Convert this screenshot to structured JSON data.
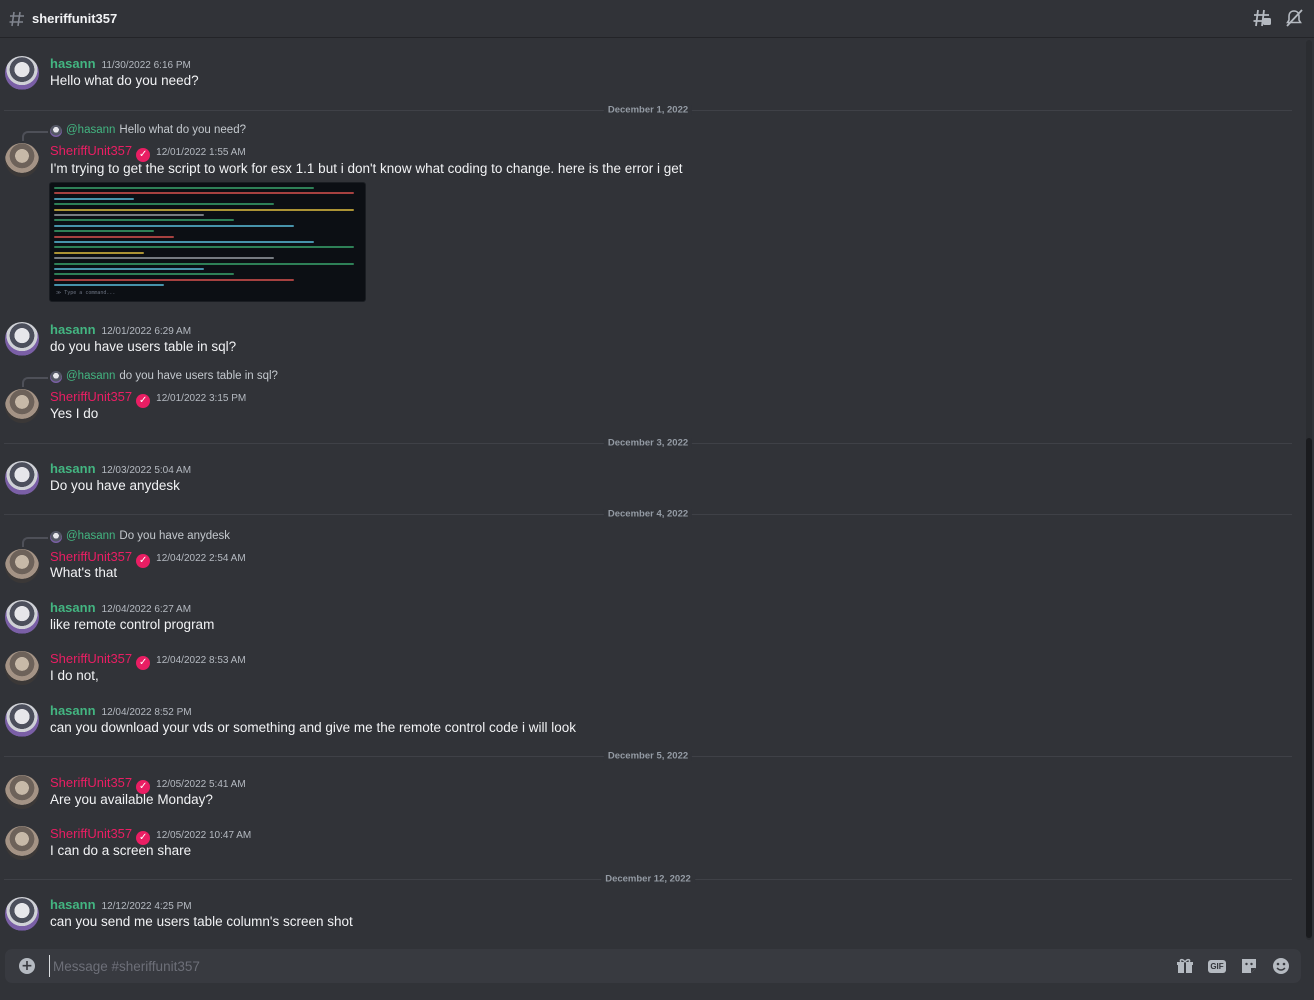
{
  "channel": {
    "name": "sheriffunit357"
  },
  "composer": {
    "placeholder": "Message #sheriffunit357"
  },
  "dividers": [
    "December 1, 2022",
    "December 3, 2022",
    "December 4, 2022",
    "December 5, 2022",
    "December 12, 2022"
  ],
  "messages": [
    {
      "author": "hasann",
      "timestamp": "11/30/2022 6:16 PM",
      "text": "Hello what do you need?"
    },
    {
      "author": "SheriffUnit357",
      "timestamp": "12/01/2022 1:55 AM",
      "text": "I'm trying to get the script to work for esx 1.1 but i don't know what coding to change. here is the error i get",
      "reply": {
        "author": "@hasann",
        "text": "Hello what do you need?"
      }
    },
    {
      "author": "hasann",
      "timestamp": "12/01/2022 6:29 AM",
      "text": "do you have users table in sql?"
    },
    {
      "author": "SheriffUnit357",
      "timestamp": "12/01/2022 3:15 PM",
      "text": "Yes I do",
      "reply": {
        "author": "@hasann",
        "text": "do you have users table in sql?"
      }
    },
    {
      "author": "hasann",
      "timestamp": "12/03/2022 5:04 AM",
      "text": "Do you have anydesk"
    },
    {
      "author": "SheriffUnit357",
      "timestamp": "12/04/2022 2:54 AM",
      "text": "What's that",
      "reply": {
        "author": "@hasann",
        "text": "Do you have anydesk"
      }
    },
    {
      "author": "hasann",
      "timestamp": "12/04/2022 6:27 AM",
      "text": "like remote control program"
    },
    {
      "author": "SheriffUnit357",
      "timestamp": "12/04/2022 8:53 AM",
      "text": "I do not,"
    },
    {
      "author": "hasann",
      "timestamp": "12/04/2022 8:52 PM",
      "text": "can you download your vds or something and give me the remote control code i will look"
    },
    {
      "author": "SheriffUnit357",
      "timestamp": "12/05/2022 5:41 AM",
      "text": "Are you available Monday?"
    },
    {
      "author": "SheriffUnit357",
      "timestamp": "12/05/2022 10:47 AM",
      "text": "I can do a screen share"
    },
    {
      "author": "hasann",
      "timestamp": "12/12/2022 4:25 PM",
      "text": "can you send me users table column's screen shot"
    }
  ],
  "attachment": {
    "prompt": "≫ Type a command..."
  },
  "icons": {
    "header": [
      "threads-icon",
      "notification-off-icon"
    ],
    "composer": [
      "add-icon",
      "gift-icon",
      "gif-icon",
      "sticker-icon",
      "emoji-icon"
    ]
  },
  "colors": {
    "hasann": "#43b581",
    "sheriff": "#e91e63",
    "background": "#313338"
  },
  "composer_labels": {
    "gif": "GIF",
    "plus": "+"
  },
  "badge_glyph": "✓"
}
